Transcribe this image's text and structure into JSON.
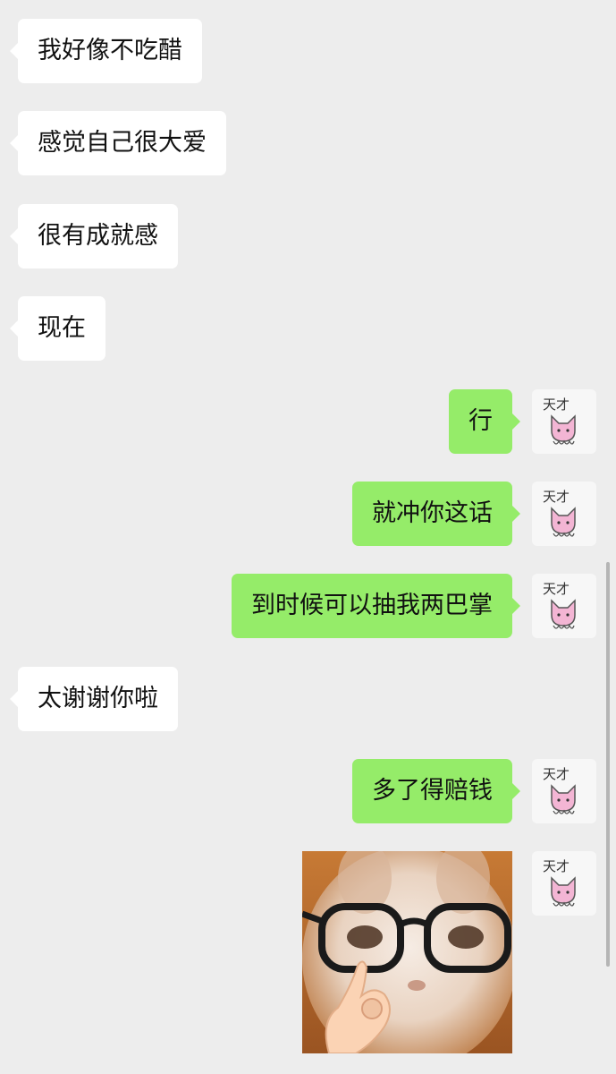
{
  "conversation": {
    "messages": [
      {
        "side": "in",
        "text": "我好像不吃醋"
      },
      {
        "side": "in",
        "text": "感觉自己很大爱"
      },
      {
        "side": "in",
        "text": "很有成就感"
      },
      {
        "side": "in",
        "text": "现在"
      },
      {
        "side": "out",
        "text": "行"
      },
      {
        "side": "out",
        "text": "就冲你这话"
      },
      {
        "side": "out",
        "text": "到时候可以抽我两巴掌"
      },
      {
        "side": "in",
        "text": "太谢谢你啦"
      },
      {
        "side": "out",
        "text": "多了得赔钱"
      },
      {
        "side": "out",
        "type": "image",
        "image": "cat-with-glasses-meme"
      }
    ]
  },
  "self_avatar": {
    "label": "天才",
    "icon": "pink-cat-icon"
  },
  "colors": {
    "background": "#ededed",
    "incoming_bubble": "#ffffff",
    "outgoing_bubble": "#95ec69"
  }
}
